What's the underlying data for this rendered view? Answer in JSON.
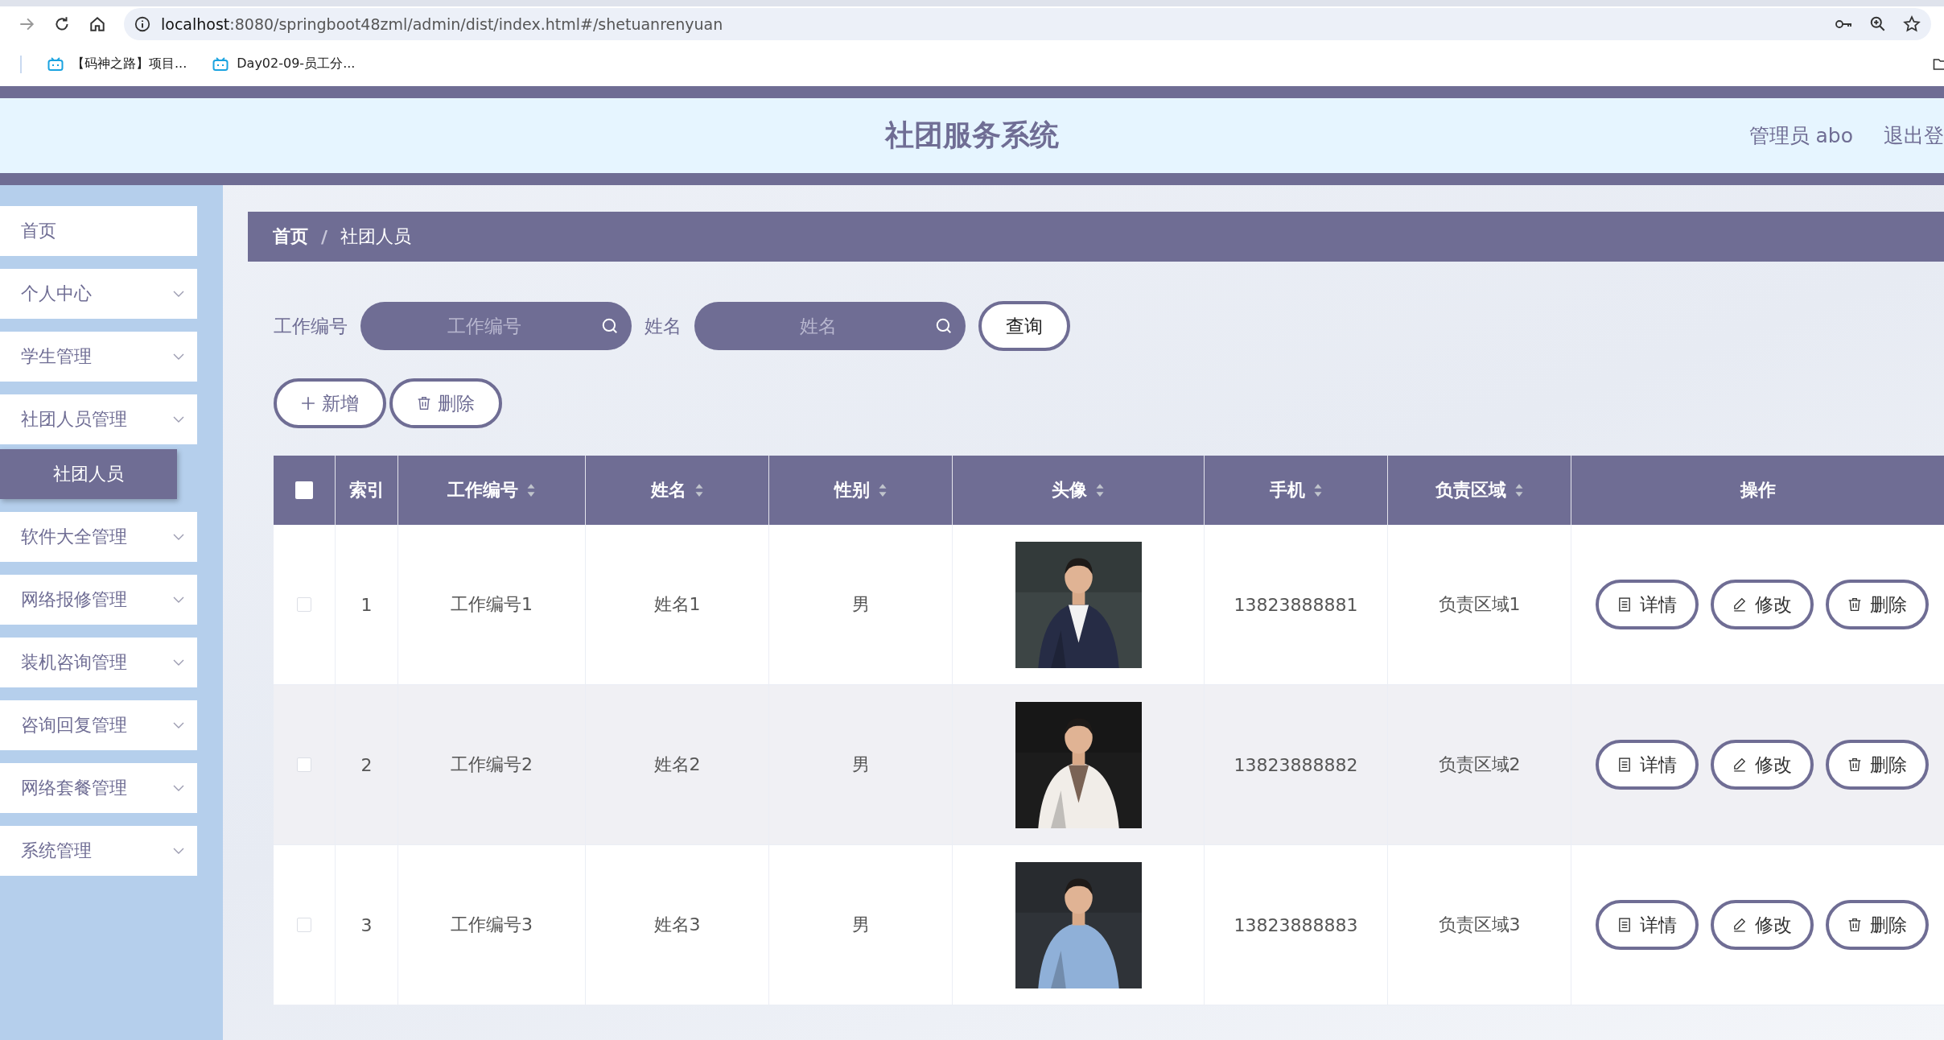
{
  "browser": {
    "url_host": "localhost",
    "url_rest": ":8080/springboot48zml/admin/dist/index.html#/shetuanrenyuan",
    "bookmarks": [
      "【码神之路】项目...",
      "Day02-09-员工分..."
    ]
  },
  "header": {
    "title": "社团服务系统",
    "user": "管理员 abo",
    "logout": "退出登"
  },
  "sidebar": [
    {
      "label": "首页",
      "expandable": false,
      "selected": false
    },
    {
      "label": "个人中心",
      "expandable": true,
      "selected": false
    },
    {
      "label": "学生管理",
      "expandable": true,
      "selected": false
    },
    {
      "label": "社团人员管理",
      "expandable": true,
      "selected": false,
      "children": [
        {
          "label": "社团人员",
          "selected": true
        }
      ]
    },
    {
      "label": "软件大全管理",
      "expandable": true,
      "selected": false
    },
    {
      "label": "网络报修管理",
      "expandable": true,
      "selected": false
    },
    {
      "label": "装机咨询管理",
      "expandable": true,
      "selected": false
    },
    {
      "label": "咨询回复管理",
      "expandable": true,
      "selected": false
    },
    {
      "label": "网络套餐管理",
      "expandable": true,
      "selected": false
    },
    {
      "label": "系统管理",
      "expandable": true,
      "selected": false
    }
  ],
  "breadcrumb": {
    "separator": "/",
    "items": [
      "首页",
      "社团人员"
    ]
  },
  "search": {
    "fields": [
      {
        "label": "工作编号",
        "placeholder": "工作编号"
      },
      {
        "label": "姓名",
        "placeholder": "姓名"
      }
    ],
    "button": "查询"
  },
  "actions": [
    {
      "kind": "add",
      "label": "新增"
    },
    {
      "kind": "delete",
      "label": "删除"
    }
  ],
  "table": {
    "header_checked": false,
    "columns": [
      {
        "label": "索引",
        "sortable": false
      },
      {
        "label": "工作编号",
        "sortable": true
      },
      {
        "label": "姓名",
        "sortable": true
      },
      {
        "label": "性别",
        "sortable": true
      },
      {
        "label": "头像",
        "sortable": true
      },
      {
        "label": "手机",
        "sortable": true
      },
      {
        "label": "负责区域",
        "sortable": true
      },
      {
        "label": "操作",
        "sortable": false
      }
    ],
    "rows": [
      {
        "checked": false,
        "index": "1",
        "work_id": "工作编号1",
        "name": "姓名1",
        "gender": "男",
        "phone": "13823888881",
        "area": "负责区域1",
        "actions": [
          {
            "kind": "detail",
            "label": "详情"
          },
          {
            "kind": "edit",
            "label": "修改"
          },
          {
            "kind": "delete",
            "label": "删除"
          }
        ]
      },
      {
        "checked": false,
        "index": "2",
        "work_id": "工作编号2",
        "name": "姓名2",
        "gender": "男",
        "phone": "13823888882",
        "area": "负责区域2",
        "actions": [
          {
            "kind": "detail",
            "label": "详情"
          },
          {
            "kind": "edit",
            "label": "修改"
          },
          {
            "kind": "delete",
            "label": "删除"
          }
        ]
      },
      {
        "checked": false,
        "index": "3",
        "work_id": "工作编号3",
        "name": "姓名3",
        "gender": "男",
        "phone": "13823888883",
        "area": "负责区域3",
        "actions": [
          {
            "kind": "detail",
            "label": "详情"
          },
          {
            "kind": "edit",
            "label": "修改"
          },
          {
            "kind": "delete",
            "label": "删除"
          }
        ]
      }
    ]
  }
}
